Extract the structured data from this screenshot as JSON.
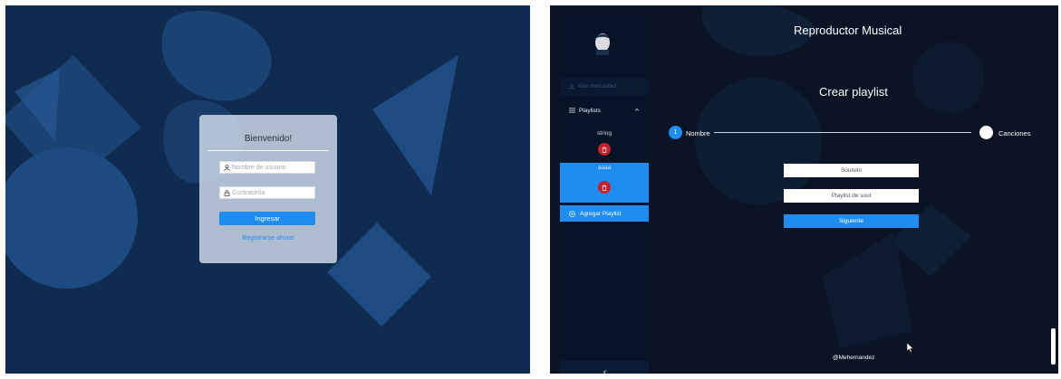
{
  "login": {
    "title": "Bienvenido!",
    "username_placeholder": "Nombre de usuario",
    "password_placeholder": "Contraseña",
    "submit_label": "Ingresar",
    "register_link": "Registrarse ahora!"
  },
  "app": {
    "title": "Reproductor Musical",
    "sidebar": {
      "avatar_icon": "user-avatar-icon",
      "user_name": "Kike Hernandez",
      "playlists_label": "Playlists",
      "playlists": [
        {
          "name": "string",
          "selected": false
        },
        {
          "name": "aaaa",
          "selected": true
        }
      ],
      "add_playlist_label": "Agregar Playlist",
      "collapse_icon": "chevron-left-icon"
    },
    "main": {
      "heading": "Crear playlist",
      "steps": [
        {
          "number": "1",
          "label": "Nombre",
          "active": true
        },
        {
          "number": "",
          "label": "Canciones",
          "active": false
        }
      ],
      "name_value": "Soulsito",
      "description_value": "Playlist de soul",
      "next_label": "Siguiente"
    },
    "footer": "@Mehernandez"
  },
  "colors": {
    "accent": "#1f8cef",
    "login_bg": "#0f2b4f",
    "app_bg": "#0a1424",
    "sidebar_bg": "#071427",
    "danger": "#c8202a"
  }
}
